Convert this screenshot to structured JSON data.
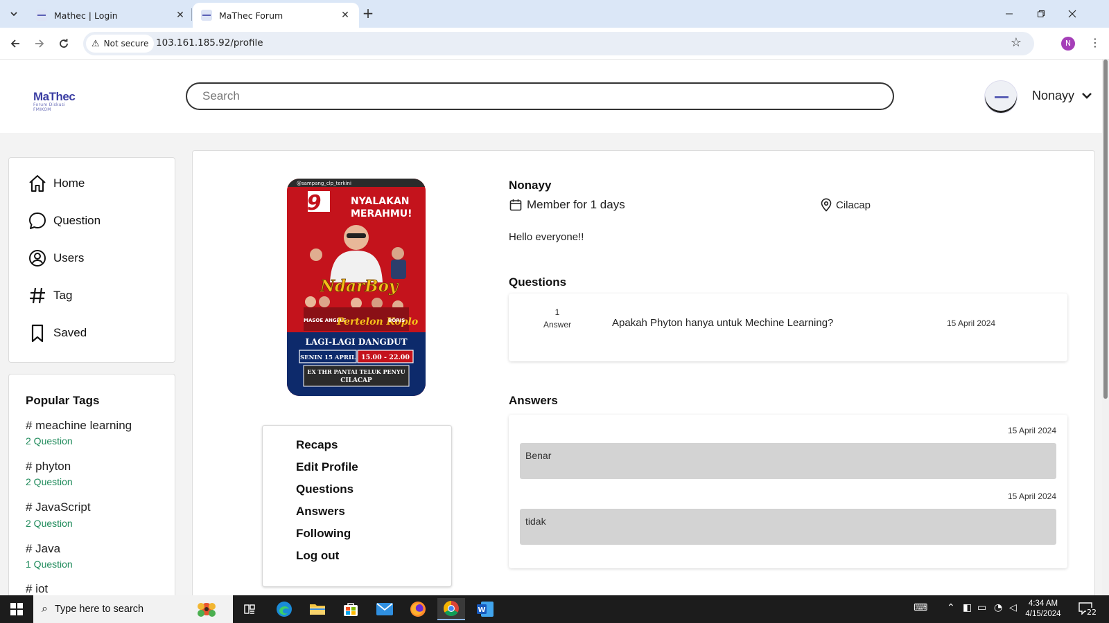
{
  "browser": {
    "tabs": [
      {
        "label": "Mathec | Login"
      },
      {
        "label": "MaThec Forum"
      }
    ],
    "security_label": "Not secure",
    "url": "103.161.185.92/profile",
    "profile_initial": "N"
  },
  "header": {
    "logo_text": "MaThec",
    "logo_subtext": "Forum Diskusi FMIKOM",
    "search_placeholder": "Search",
    "username": "Nonayy"
  },
  "sidebar": {
    "items": [
      {
        "label": "Home",
        "icon": "home-icon"
      },
      {
        "label": "Question",
        "icon": "chat-bubble-icon"
      },
      {
        "label": "Users",
        "icon": "user-circle-icon"
      },
      {
        "label": "Tag",
        "icon": "hash-icon"
      },
      {
        "label": "Saved",
        "icon": "bookmark-icon"
      }
    ]
  },
  "popular_tags": {
    "title": "Popular Tags",
    "items": [
      {
        "name": "# meachine learning",
        "count": "2 Question"
      },
      {
        "name": "# phyton",
        "count": "2 Question"
      },
      {
        "name": "# JavaScript",
        "count": "2 Question"
      },
      {
        "name": "# Java",
        "count": "1 Question"
      },
      {
        "name": "# iot",
        "count": ""
      }
    ]
  },
  "profile": {
    "name": "Nonayy",
    "member_since": "Member for 1 days",
    "location": "Cilacap",
    "bio": "Hello everyone!!",
    "photo": {
      "watermark": "@sampang_clp_terkini",
      "headline_1": "NYALAKAN",
      "headline_2": "MERAHMU!",
      "performer": "NdarBoy",
      "group_left": "MASOE ANGELS",
      "group_right": "BORIS",
      "band": "Pertelon Koplo",
      "event": "LAGI-LAGI DANGDUT",
      "date": "SENIN 15 APRIL",
      "time": "15.00 - 22.00",
      "venue_1": "EX THR PANTAI TELUK PENYU",
      "venue_2": "CILACAP"
    },
    "menu": [
      "Recaps",
      "Edit Profile",
      "Questions",
      "Answers",
      "Following",
      "Log out"
    ]
  },
  "questions": {
    "title": "Questions",
    "items": [
      {
        "answer_count": "1",
        "answer_label": "Answer",
        "title": "Apakah Phyton hanya untuk Mechine Learning?",
        "date": "15 April 2024"
      }
    ]
  },
  "answers": {
    "title": "Answers",
    "items": [
      {
        "date": "15 April 2024",
        "text": "Benar"
      },
      {
        "date": "15 April 2024",
        "text": "tidak"
      }
    ]
  },
  "taskbar": {
    "search_placeholder": "Type here to search",
    "time": "4:34 AM",
    "date": "4/15/2024",
    "notification_count": "22"
  },
  "colors": {
    "tag_count_green": "#1e8a5a",
    "brand_blue": "#3b3ea3",
    "answer_bg": "#d3d3d3"
  }
}
